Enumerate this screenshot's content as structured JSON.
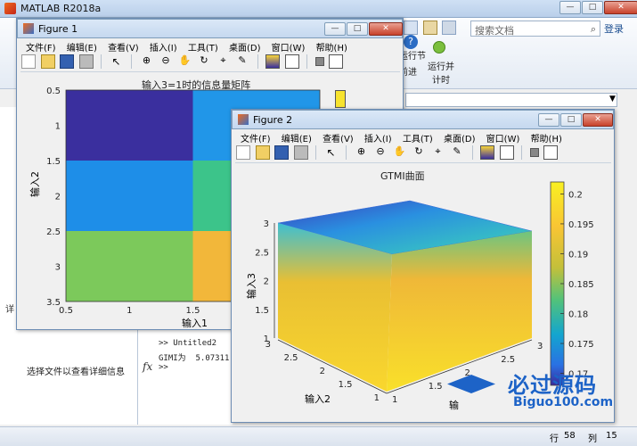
{
  "matlab": {
    "title": "MATLAB R2018a",
    "search_placeholder": "搜索文档",
    "login_label": "登录",
    "ribbon_run_section": "运行节",
    "ribbon_advance": "前进",
    "ribbon_run_time": "运行并\n计时",
    "details_label": "选择文件以查看详细信息",
    "details_short": "详",
    "cmd_lines": [
      ">> Untitled2",
      "GIMI为  5.07311",
      ">>"
    ],
    "status_row_label": "行",
    "status_row_value": "58",
    "status_col_label": "列",
    "status_col_value": "15"
  },
  "figure1": {
    "title": "Figure 1",
    "menu": [
      "文件(F)",
      "编辑(E)",
      "查看(V)",
      "插入(I)",
      "工具(T)",
      "桌面(D)",
      "窗口(W)",
      "帮助(H)"
    ],
    "plot_title": "输入3=1时的信息量矩阵",
    "xlabel": "输入1",
    "ylabel": "输入2",
    "xticks": [
      "0.5",
      "1",
      "1.5",
      "2",
      "2"
    ],
    "yticks": [
      "0.5",
      "1",
      "1.5",
      "2",
      "2.5",
      "3",
      "3.5"
    ]
  },
  "figure2": {
    "title": "Figure 2",
    "menu": [
      "文件(F)",
      "编辑(E)",
      "查看(V)",
      "插入(I)",
      "工具(T)",
      "桌面(D)",
      "窗口(W)",
      "帮助(H)"
    ],
    "plot_title": "GTMI曲面",
    "zlabel": "输入3",
    "xlabel_left": "输入2",
    "xlabel_right": "输",
    "zticks": [
      "3",
      "2.5",
      "2",
      "1.5",
      "1"
    ],
    "left_ticks": [
      "3",
      "2.5",
      "2",
      "1.5",
      "1"
    ],
    "right_ticks": [
      "1",
      "1.5",
      "2",
      "2.5",
      "3"
    ],
    "colorbar_ticks": [
      "0.2",
      "0.195",
      "0.19",
      "0.185",
      "0.18",
      "0.175",
      "0.17"
    ]
  },
  "chart_data": [
    {
      "type": "heatmap",
      "title": "输入3=1时的信息量矩阵",
      "xlabel": "输入1",
      "ylabel": "输入2",
      "xlim": [
        0.5,
        2.5
      ],
      "ylim": [
        0.5,
        3.5
      ],
      "cells": [
        {
          "x": 1,
          "y": 1,
          "color": "#3a2f9e"
        },
        {
          "x": 2,
          "y": 1,
          "color": "#2196e8"
        },
        {
          "x": 1,
          "y": 2,
          "color": "#1e8ee8"
        },
        {
          "x": 2,
          "y": 2,
          "color": "#3cc48a"
        },
        {
          "x": 1,
          "y": 3,
          "color": "#7cc95b"
        },
        {
          "x": 2,
          "y": 3,
          "color": "#f2b73a"
        }
      ]
    },
    {
      "type": "surface3d",
      "title": "GTMI曲面",
      "colorbar_range": [
        0.168,
        0.202
      ],
      "colorbar_ticks": [
        0.2,
        0.195,
        0.19,
        0.185,
        0.18,
        0.175,
        0.17
      ],
      "axes_ranges": {
        "input2": [
          1,
          3
        ],
        "input3": [
          1,
          3
        ],
        "input1": [
          1,
          3
        ]
      }
    }
  ],
  "watermark": {
    "text_cn": "必过源码",
    "text_en": "Biguo100.com"
  }
}
